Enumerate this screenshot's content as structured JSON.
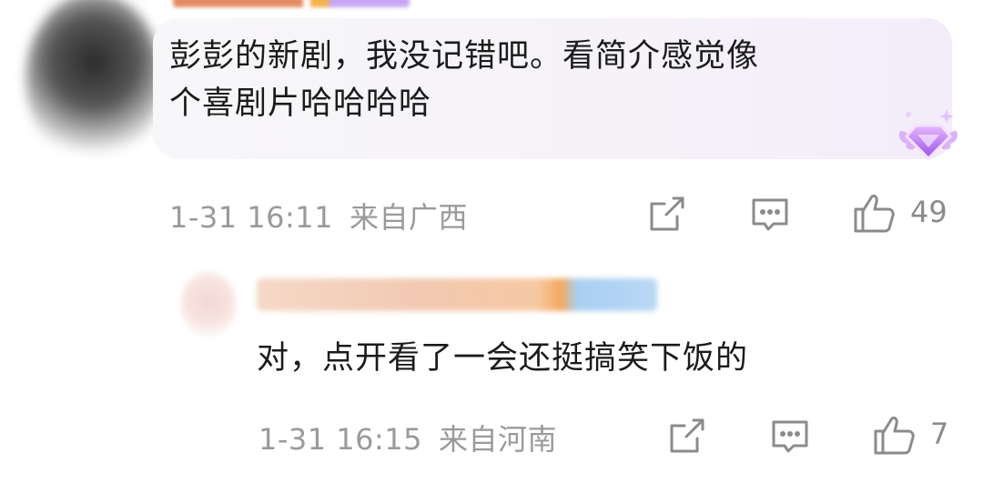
{
  "comments": [
    {
      "text_line1": "彭彭的新剧，我没记错吧。看简介感觉像",
      "text_line2": "个喜剧片哈哈哈哈",
      "date": "1-31 16:11",
      "location": "来自广西",
      "likes": "49"
    },
    {
      "text": "对，点开看了一会还挺搞笑下饭的",
      "date": "1-31 16:15",
      "location": "来自河南",
      "likes": "7"
    }
  ],
  "icons": {
    "share": "share-icon",
    "comment": "comment-icon",
    "like": "thumbs-up-icon",
    "badge": "diamond-badge-icon"
  },
  "colors": {
    "text": "#1b1b1b",
    "meta": "#9a9a9a",
    "badge": "#b06cf0"
  }
}
